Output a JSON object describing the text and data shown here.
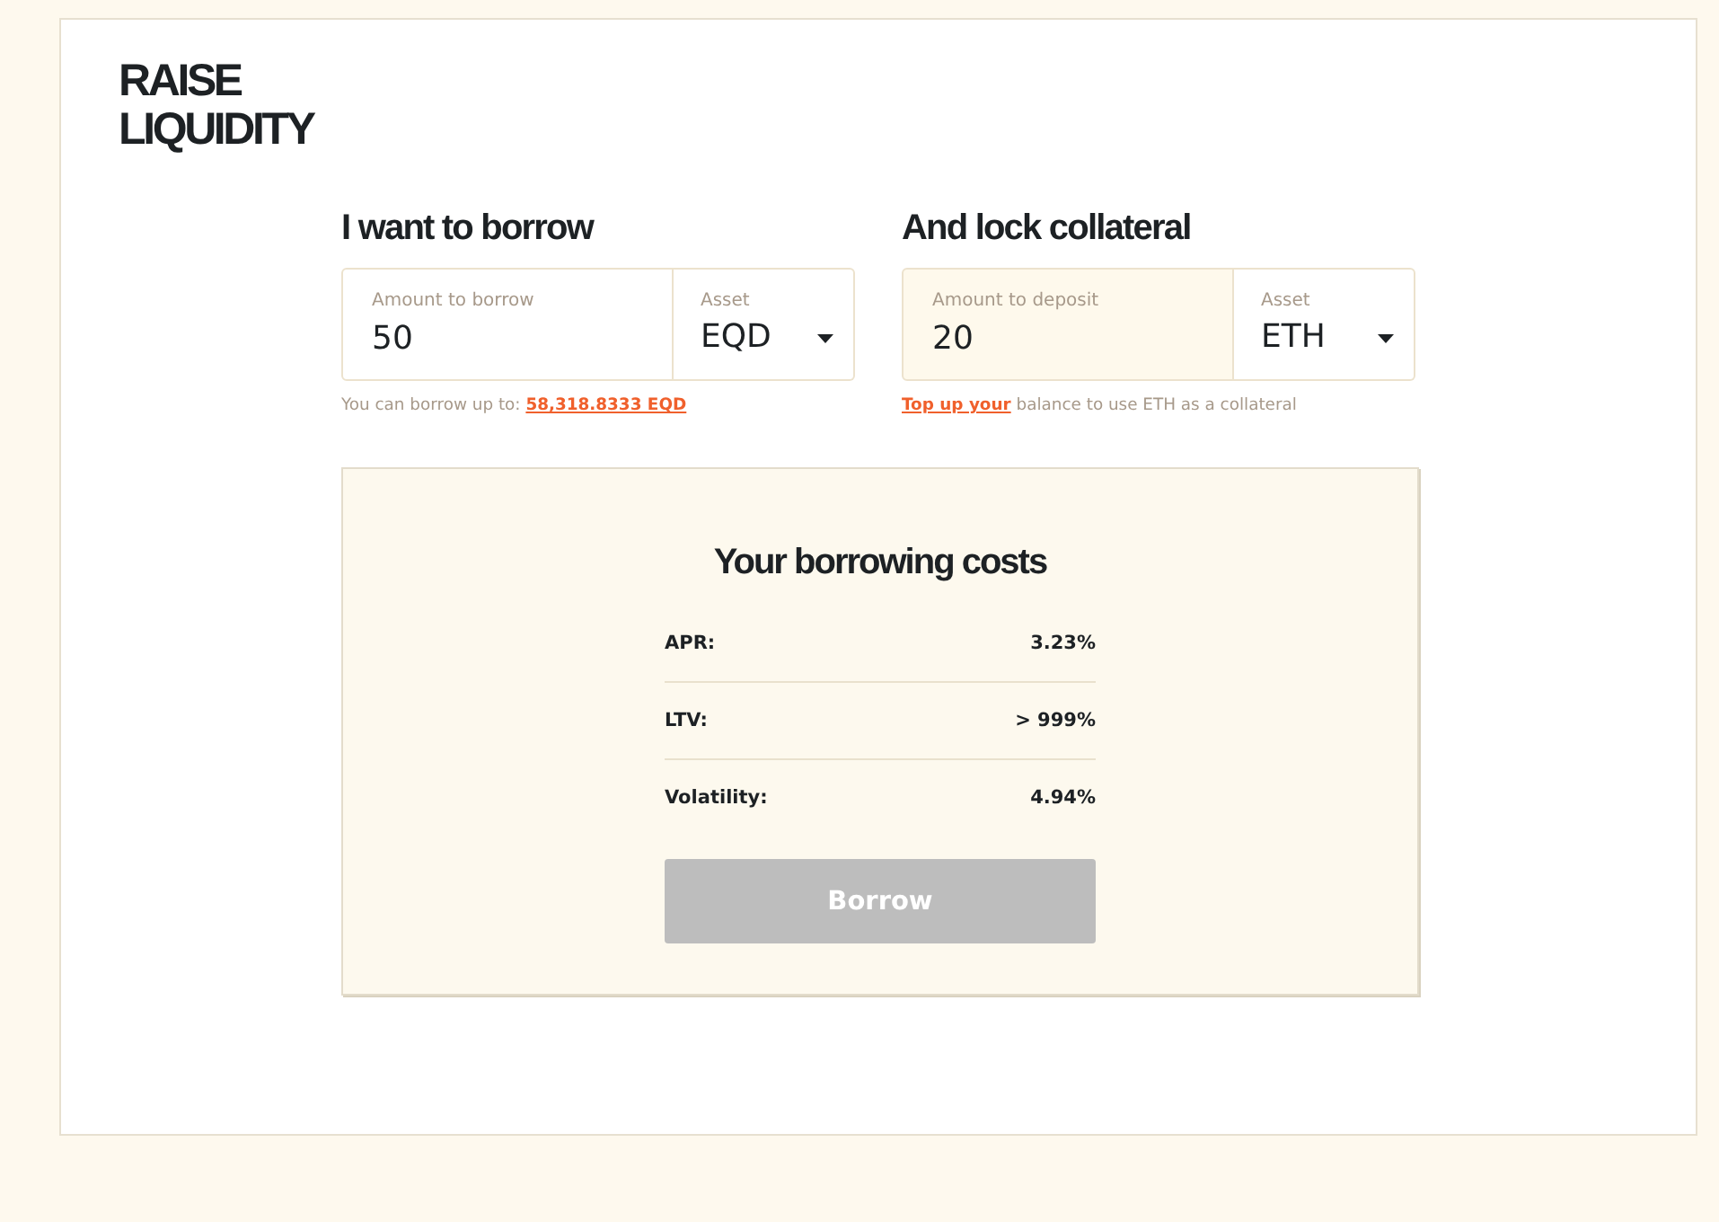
{
  "page": {
    "title": "RAISE LIQUIDITY"
  },
  "borrow": {
    "heading": "I want to borrow",
    "amount": {
      "label": "Amount to borrow",
      "value": "50",
      "focused": false
    },
    "asset": {
      "label": "Asset",
      "value": "EQD"
    },
    "hint": [
      {
        "kind": "text",
        "text": "You can borrow up to: "
      },
      {
        "kind": "link",
        "text": "58,318.8333 EQD"
      }
    ]
  },
  "collateral": {
    "heading": "And lock collateral",
    "amount": {
      "label": "Amount to deposit",
      "value": "20",
      "focused": true
    },
    "asset": {
      "label": "Asset",
      "value": "ETH"
    },
    "hint": [
      {
        "kind": "link",
        "text": "Top up your"
      },
      {
        "kind": "text",
        "text": " balance to use ETH as a collateral"
      }
    ]
  },
  "costs": {
    "title": "Your borrowing costs",
    "rows": [
      {
        "label": "APR:",
        "value": "3.23%"
      },
      {
        "label": "LTV:",
        "value": "> 999%"
      },
      {
        "label": "Volatility:",
        "value": "4.94%"
      }
    ],
    "button": {
      "label": "Borrow",
      "disabled": true
    }
  }
}
